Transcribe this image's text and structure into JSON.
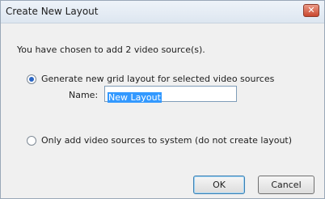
{
  "window": {
    "title": "Create New Layout",
    "close_glyph": "✕"
  },
  "dialog": {
    "message": "You have chosen to add 2 video source(s).",
    "option_grid": {
      "label": "Generate new grid layout for selected video sources",
      "selected": true
    },
    "name_field": {
      "label": "Name:",
      "value": "New Layout"
    },
    "option_only_add": {
      "label": "Only add video sources to system (do not create layout)",
      "selected": false
    }
  },
  "buttons": {
    "ok": "OK",
    "cancel": "Cancel"
  }
}
